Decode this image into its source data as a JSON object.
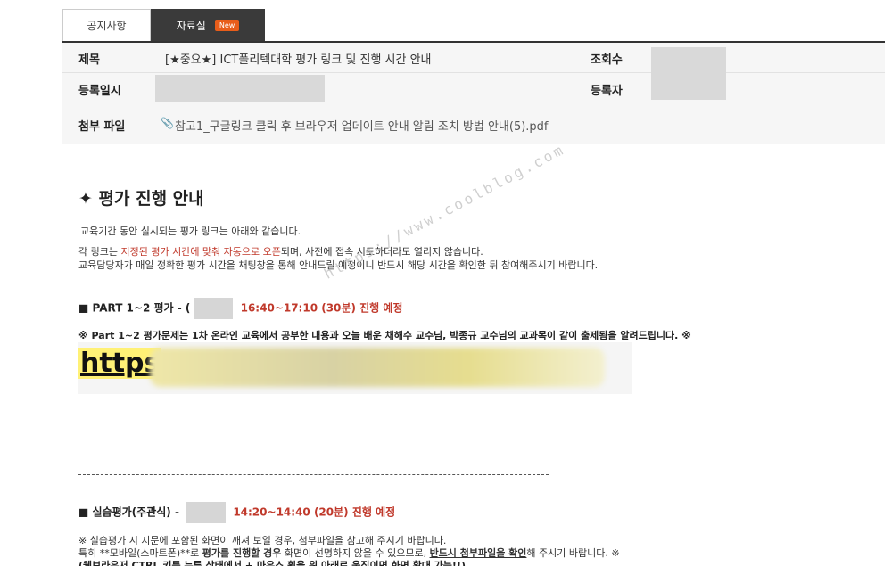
{
  "tabs": {
    "notice": "공지사항",
    "files": "자료실",
    "files_badge": "New"
  },
  "info": {
    "title_label": "제목",
    "title_value": "[★중요★] ICT폴리텍대학 평가 링크 및 진행 시간 안내",
    "views_label": "조회수",
    "date_label": "등록일시",
    "author_label": "등록자",
    "attach_label": "첨부 파일",
    "attach_file": "참고1_구글링크 클릭 후 브라우저 업데이트 안내 알림 조치 방법 안내(5).pdf"
  },
  "content": {
    "heading": "✦ 평가 진행 안내",
    "intro": "교육기간 동안 실시되는 평가 링크는 아래와 같습니다.",
    "line2_pre": "각 링크는 ",
    "line2_red": "지정된 평가 시간에 맞춰 자동으로 오픈",
    "line2_post": "되며, 사전에 접속 시도하더라도 열리지 않습니다.",
    "line3": "교육담당자가 매일 정확한 평가 시간을 채팅창을 통해 안내드릴 예정이니 반드시 해당 시간을 확인한 뒤 참여해주시기 바랍니다.",
    "part12_label": "■ PART 1~2 평가  - (",
    "part12_time": "16:40~17:10 (30분) 진행 예정",
    "note1": "※ Part 1~2 평가문제는 1차 온라인 교육에서 공부한 내용과 오늘 배운 채해수 교수님, 박종규 교수님의 교과목이 같이 출제됨을 알려드립니다. ※",
    "link_text": "https",
    "practice_label": "■ 실습평가(주관식) -",
    "practice_time": "14:20~14:40 (20분) 진행 예정",
    "note2": "※ 실습평가 시 지문에 포함된 화면이 깨져 보일 경우, 첨부파일을 참고해 주시기 바랍니다.",
    "note3_pre": "특히 **모바일(스마트폰)**로 ",
    "note3_bold": "평가를 진행할 경우",
    "note3_mid": " 화면이 선명하지 않을 수 있으므로, ",
    "note3_ul": "반드시 첨부파일을 확인",
    "note3_post": "해 주시기 바랍니다. ※",
    "note4": "(웹브라우저 CTRL 키를 누른 상태에서 + 마우스 휠을 위 아래로 움직이면 화면 확대 가능!!)",
    "watermark": "https://www.coolblog.com"
  },
  "colors": {
    "accent_red": "#c0392b",
    "tab_dark": "#3a3a3a",
    "badge_orange": "#e85d1a",
    "highlight_yellow": "#fff176"
  }
}
